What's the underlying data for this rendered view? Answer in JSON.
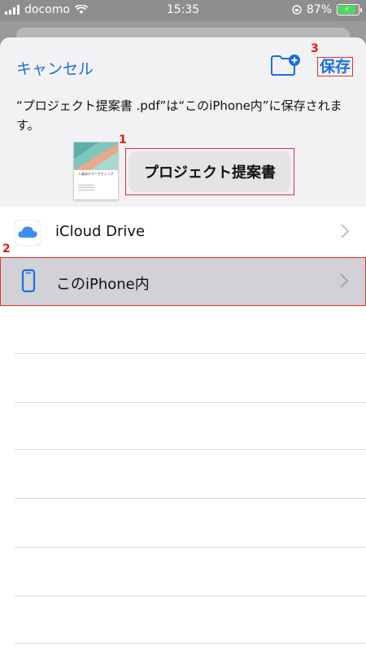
{
  "status_bar": {
    "carrier": "docomo",
    "time": "15:35",
    "battery_percent": "87%",
    "battery_fill": 0.87
  },
  "header": {
    "cancel_label": "キャンセル",
    "save_label": "保存"
  },
  "message": "“プロジェクト提案書 .pdf”は“このiPhone内”に保存されます。",
  "thumbnail": {
    "doc_title": "人員あけマーケティング"
  },
  "file_name": "プロジェクト提案書",
  "markers": {
    "one": "1",
    "two": "2",
    "three": "3"
  },
  "locations": [
    {
      "label": "iCloud Drive",
      "icon": "icloud-icon"
    },
    {
      "label": "このiPhone内",
      "icon": "iphone-icon",
      "selected": true
    }
  ],
  "colors": {
    "accent": "#1a6fe0",
    "highlight": "#e03030",
    "selected_row": "#d1d1d6"
  }
}
